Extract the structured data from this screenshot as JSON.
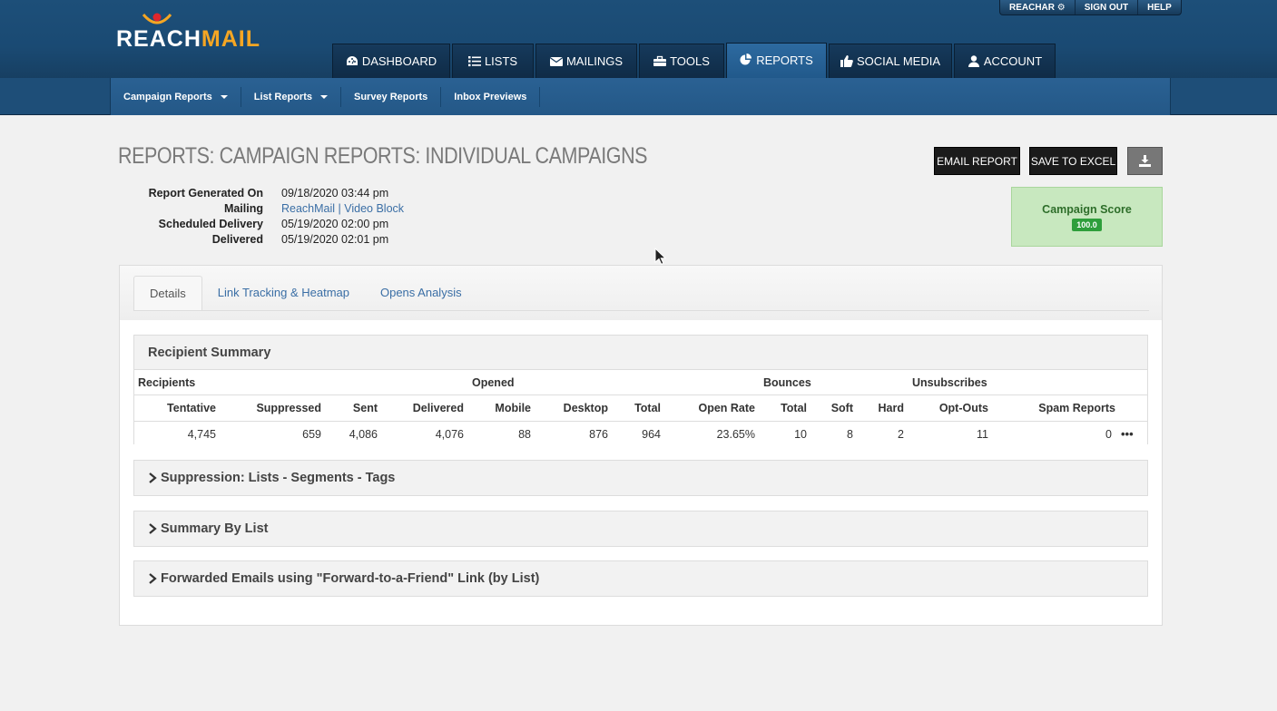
{
  "logo": {
    "part1": "REACH",
    "part2": "MAIL"
  },
  "util_links": [
    "REACHAR",
    "SIGN OUT",
    "HELP"
  ],
  "colors": {
    "header": "#1d4f79",
    "subnav": "#2a6193",
    "active_tab": "#2d6aa0",
    "link": "#3a6ea5",
    "score_bg": "#c8e8bf",
    "score_badge": "#2e9e3b"
  },
  "main_nav": [
    {
      "label": "DASHBOARD",
      "icon": "dashboard-icon"
    },
    {
      "label": "LISTS",
      "icon": "list-icon"
    },
    {
      "label": "MAILINGS",
      "icon": "envelope-icon"
    },
    {
      "label": "TOOLS",
      "icon": "toolbox-icon"
    },
    {
      "label": "REPORTS",
      "icon": "pie-chart-icon",
      "active": true
    },
    {
      "label": "SOCIAL MEDIA",
      "icon": "thumbs-up-icon"
    },
    {
      "label": "ACCOUNT",
      "icon": "user-icon"
    }
  ],
  "sub_nav": [
    {
      "label": "Campaign Reports",
      "dropdown": true
    },
    {
      "label": "List Reports",
      "dropdown": true
    },
    {
      "label": "Survey Reports"
    },
    {
      "label": "Inbox Previews"
    }
  ],
  "page": {
    "title": "REPORTS: CAMPAIGN REPORTS: INDIVIDUAL CAMPAIGNS",
    "email_report": "EMAIL REPORT",
    "save_excel": "SAVE TO EXCEL",
    "download_icon": "download-icon"
  },
  "meta": {
    "generated_label": "Report Generated On",
    "generated": "09/18/2020 03:44 pm",
    "mailing_label": "Mailing",
    "mailing": "ReachMail | Video Block",
    "scheduled_label": "Scheduled Delivery",
    "scheduled": "05/19/2020 02:00 pm",
    "delivered_label": "Delivered",
    "delivered": "05/19/2020 02:01 pm"
  },
  "score": {
    "title": "Campaign Score",
    "value": "100.0"
  },
  "tabs": [
    "Details",
    "Link Tracking & Heatmap",
    "Opens Analysis"
  ],
  "recipient_summary": {
    "title": "Recipient Summary",
    "groups": [
      "Recipients",
      "Opened",
      "Bounces",
      "Unsubscribes"
    ],
    "headers": [
      "Tentative",
      "Suppressed",
      "Sent",
      "Delivered",
      "Mobile",
      "Desktop",
      "Total",
      "Open Rate",
      "Total",
      "Soft",
      "Hard",
      "Opt-Outs",
      "Spam Reports"
    ],
    "values": [
      "4,745",
      "659",
      "4,086",
      "4,076",
      "88",
      "876",
      "964",
      "23.65%",
      "10",
      "8",
      "2",
      "11",
      "0"
    ],
    "more": "•••"
  },
  "sections": [
    "Suppression: Lists - Segments - Tags",
    "Summary By List",
    "Forwarded Emails using \"Forward-to-a-Friend\" Link (by List)"
  ]
}
